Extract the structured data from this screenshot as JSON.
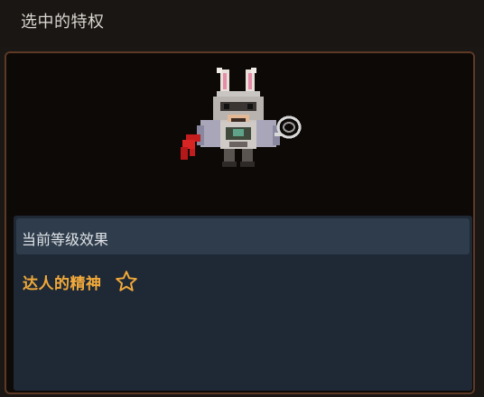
{
  "header": {
    "title": "选中的特权"
  },
  "panel": {
    "character_icon": "knight-bunny-character-icon",
    "effects": {
      "header_label": "当前等级效果",
      "perk_name": "达人的精神",
      "perk_icon": "star-outline-icon"
    }
  },
  "colors": {
    "accent_orange": "#f2a93b",
    "panel_border": "#5e3a26",
    "effects_bg": "#1e2935",
    "effects_header_bg": "#2f3c4b"
  }
}
